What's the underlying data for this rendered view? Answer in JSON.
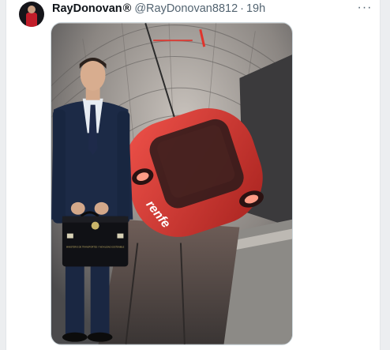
{
  "tweet": {
    "author_name": "RayDonovan",
    "badge": "®",
    "handle": "@RayDonovan8812",
    "separator": "·",
    "time": "19h",
    "more_icon": "more-horizontal-icon"
  },
  "media": {
    "train_logo": "renfe",
    "briefcase_seal": "MINISTERIO DE TRANSPORTES Y MOVILIDAD SOSTENIBLE",
    "colors": {
      "tunnel": "#8d8a87",
      "train_red": "#e03b33",
      "suit": "#1c2a46"
    }
  }
}
